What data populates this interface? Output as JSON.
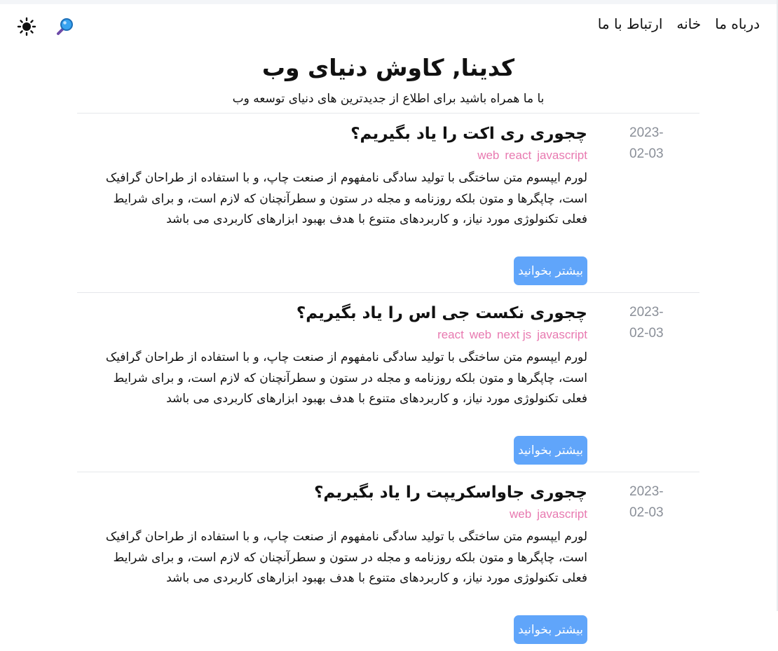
{
  "nav": {
    "items": [
      {
        "label": "درباه ما"
      },
      {
        "label": "خانه"
      },
      {
        "label": "ارتباط با ما"
      }
    ]
  },
  "tools": {
    "theme_icon": "sun-icon",
    "search_icon": "magnifier-icon"
  },
  "hero": {
    "title": "کدینا, کاوش دنیای وب",
    "subtitle": "با ما همراه باشید برای اطلاع از جدیدترین های دنیای توسعه وب"
  },
  "colors": {
    "tag": "#e879b0",
    "button": "#60a5fa",
    "date": "#8a8f98",
    "divider": "#e5e7eb"
  },
  "posts": [
    {
      "date": "2023-02-03",
      "title": "چجوری ری اکت را یاد بگیریم؟",
      "tags": [
        "web",
        "react",
        "javascript"
      ],
      "excerpt": "لورم ایپسوم متن ساختگی با تولید سادگی نامفهوم از صنعت چاپ، و با استفاده از طراحان گرافیک است، چاپگرها و متون بلکه روزنامه و مجله در ستون و سطرآنچنان که لازم است، و برای شرایط فعلی تکنولوژی مورد نیاز، و کاربردهای متنوع با هدف بهبود ابزارهای کاربردی می باشد",
      "button": "بیشتر بخوانید"
    },
    {
      "date": "2023-02-03",
      "title": "چجوری نکست جی اس را یاد بگیریم؟",
      "tags": [
        "react",
        "web",
        "next js",
        "javascript"
      ],
      "excerpt": "لورم ایپسوم متن ساختگی با تولید سادگی نامفهوم از صنعت چاپ، و با استفاده از طراحان گرافیک است، چاپگرها و متون بلکه روزنامه و مجله در ستون و سطرآنچنان که لازم است، و برای شرایط فعلی تکنولوژی مورد نیاز، و کاربردهای متنوع با هدف بهبود ابزارهای کاربردی می باشد",
      "button": "بیشتر بخوانید"
    },
    {
      "date": "2023-02-03",
      "title": "چجوری جاواسکریپت را یاد بگیریم؟",
      "tags": [
        "web",
        "javascript"
      ],
      "excerpt": "لورم ایپسوم متن ساختگی با تولید سادگی نامفهوم از صنعت چاپ، و با استفاده از طراحان گرافیک است، چاپگرها و متون بلکه روزنامه و مجله در ستون و سطرآنچنان که لازم است، و برای شرایط فعلی تکنولوژی مورد نیاز، و کاربردهای متنوع با هدف بهبود ابزارهای کاربردی می باشد",
      "button": "بیشتر بخوانید"
    }
  ]
}
